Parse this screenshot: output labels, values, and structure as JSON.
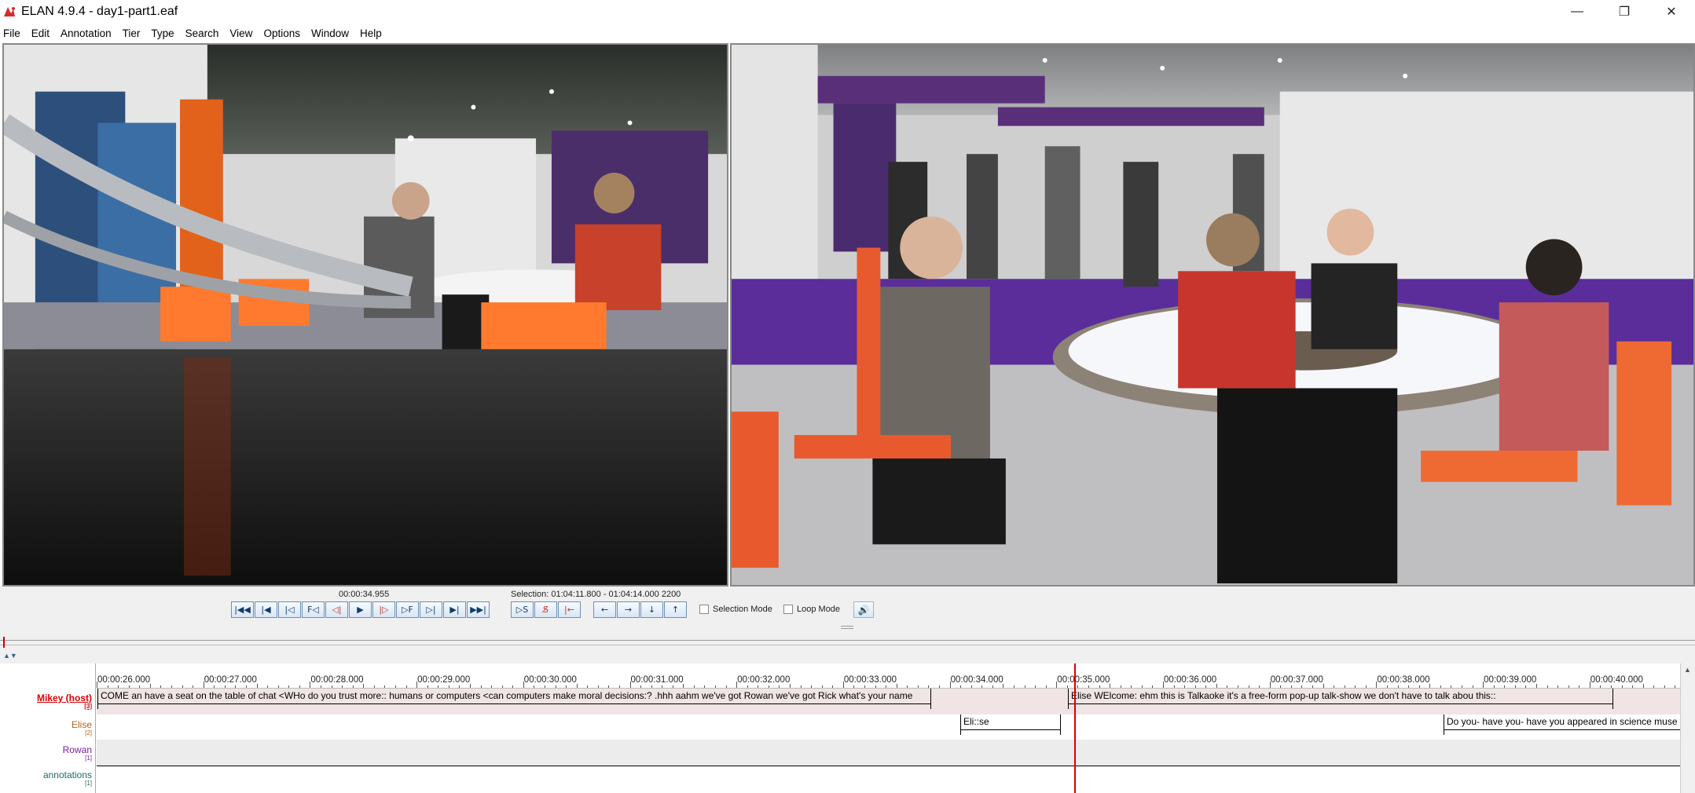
{
  "window": {
    "title": "ELAN 4.9.4 - day1-part1.eaf",
    "minimize_glyph": "—",
    "maximize_glyph": "❐",
    "close_glyph": "✕",
    "app_icon": "elan-logo-icon"
  },
  "menu": [
    "File",
    "Edit",
    "Annotation",
    "Tier",
    "Type",
    "Search",
    "View",
    "Options",
    "Window",
    "Help"
  ],
  "player": {
    "current_time": "00:00:34.955",
    "selection": "Selection: 01:04:11.800 - 01:04:14.000  2200",
    "transport_buttons": [
      {
        "glyph": "|◀◀",
        "name": "go-to-begin-icon"
      },
      {
        "glyph": "|◀",
        "name": "previous-scrollview-icon"
      },
      {
        "glyph": "|◁",
        "name": "previous-second-icon"
      },
      {
        "glyph": "F◁",
        "name": "previous-frame-icon"
      },
      {
        "glyph": "◁|",
        "name": "previous-pixel-icon"
      },
      {
        "glyph": "▶",
        "name": "play-icon"
      },
      {
        "glyph": "|▷",
        "name": "next-pixel-icon"
      },
      {
        "glyph": "▷F",
        "name": "next-frame-icon"
      },
      {
        "glyph": "▷|",
        "name": "next-second-icon"
      },
      {
        "glyph": "▶|",
        "name": "next-scrollview-icon"
      },
      {
        "glyph": "▶▶|",
        "name": "go-to-end-icon"
      }
    ],
    "selection_buttons": [
      {
        "glyph": "▷S",
        "name": "play-selection-icon"
      },
      {
        "glyph": "S̸",
        "name": "clear-selection-icon"
      },
      {
        "glyph": "|←",
        "name": "toggle-selection-boundary-icon"
      }
    ],
    "annotation_nav_buttons": [
      {
        "glyph": "←",
        "name": "previous-annotation-icon"
      },
      {
        "glyph": "→",
        "name": "next-annotation-icon"
      },
      {
        "glyph": "↓",
        "name": "annotation-down-icon"
      },
      {
        "glyph": "↑",
        "name": "annotation-up-icon"
      }
    ],
    "selection_mode_label": "Selection Mode",
    "loop_mode_label": "Loop Mode",
    "volume_icon": "speaker-icon",
    "volume_glyph": "🔊"
  },
  "timeline": {
    "ticks": [
      "00:00:26.000",
      "00:00:27.000",
      "00:00:28.000",
      "00:00:29.000",
      "00:00:30.000",
      "00:00:31.000",
      "00:00:32.000",
      "00:00:33.000",
      "00:00:34.000",
      "00:00:35.000",
      "00:00:36.000",
      "00:00:37.000",
      "00:00:38.000",
      "00:00:39.000",
      "00:00:40.000"
    ],
    "tiers": [
      {
        "name": "Mikey (host)",
        "count": "[3]"
      },
      {
        "name": "Elise",
        "count": "[2]"
      },
      {
        "name": "Rowan",
        "count": "[1]"
      },
      {
        "name": "annotations",
        "count": "[1]"
      }
    ],
    "annotations": {
      "mikey_1": "COME an have a seat on the table of chat <WHo do you trust more:: humans or computers <can computers make moral decisions:?  .hhh aahm we've got Rowan we've got Rick what's your name",
      "mikey_2": "Elise WElcome: ehm this is Talkaoke it's a free-form pop-up talk-show we don't have to talk abou this::",
      "elise_1": "Eli::se",
      "elise_2": "Do you- have you- have you appeared in science muse"
    },
    "accent_color": "#dd0000"
  }
}
